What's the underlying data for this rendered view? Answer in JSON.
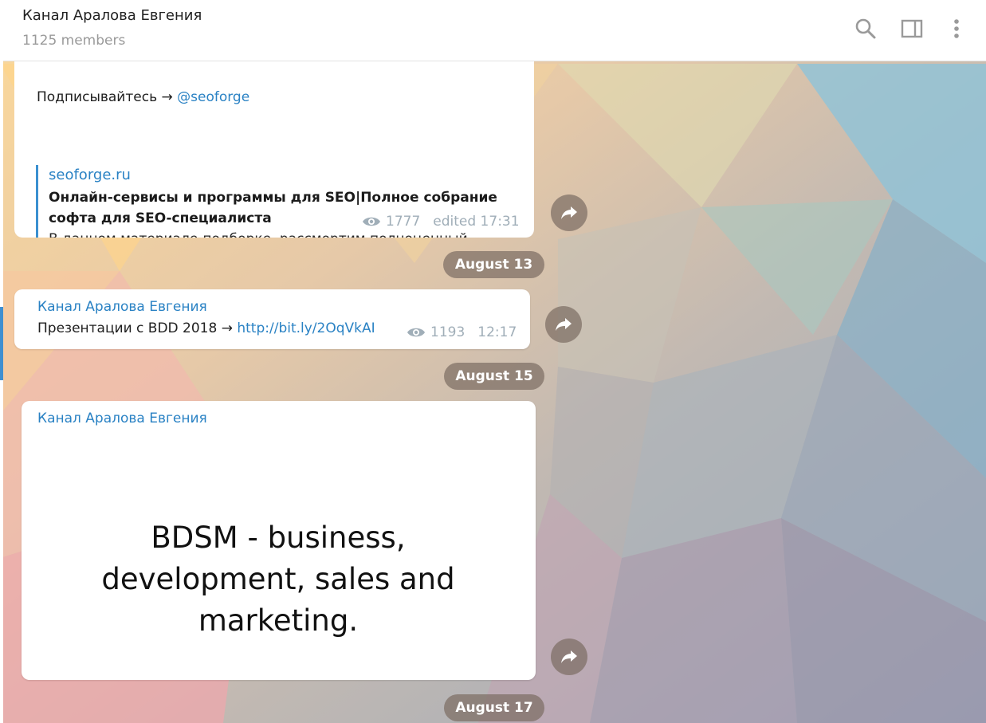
{
  "header": {
    "title": "Канал Аралова Евгения",
    "subtitle": "1125 members",
    "icons": [
      "search-icon",
      "sidebar-toggle-icon",
      "more-vertical-icon"
    ]
  },
  "messages": [
    {
      "text_prefix": "Подписывайтесь → ",
      "text_link": "@seoforge",
      "preview": {
        "site": "seoforge.ru",
        "title": "Онлайн-сервисы и программы для SEO|Полное собрание софта для SEO-специалиста",
        "description": "В данном материале-подборке, рассмортим полноценный профессиональный инструментарий ..."
      },
      "views": "1777",
      "time": "edited 17:31"
    },
    {
      "date": "August 13",
      "author": "Канал Аралова Евгения",
      "text_prefix": "Презентации с BDD 2018 → ",
      "text_link": "http://bit.ly/2OqVkAI",
      "views": "1193",
      "time": "12:17"
    },
    {
      "date": "August 15",
      "author": "Канал Аралова Евгения",
      "photo_text": "BDSM - business, development, sales and marketing."
    }
  ],
  "last_date": "August 17",
  "colors": {
    "accent": "#2a82c4",
    "pill": "#7d6e64",
    "meta": "#a0aeb8"
  }
}
